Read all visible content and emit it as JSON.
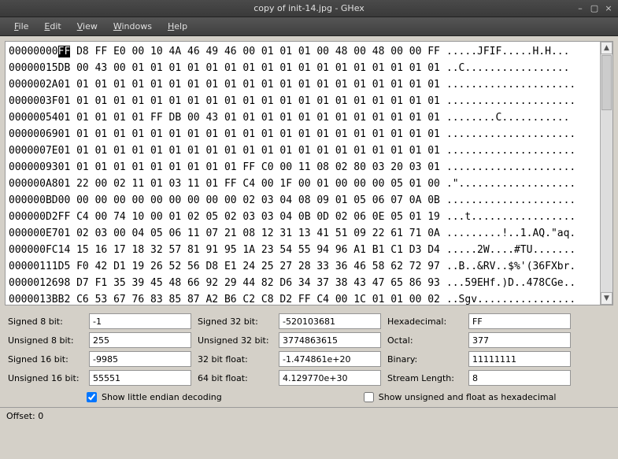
{
  "window": {
    "title": "copy of init-14.jpg - GHex"
  },
  "menu": {
    "file": "File",
    "edit": "Edit",
    "view": "View",
    "windows": "Windows",
    "help": "Help"
  },
  "hex": {
    "lines": [
      {
        "off": "00000000",
        "bytes": "FF D8 FF E0 00 10 4A 46 49 46 00 01 01 01 00 48 00 48 00 00 FF",
        "ascii": ".....JFIF.....H.H...",
        "cur": 0
      },
      {
        "off": "00000015",
        "bytes": "DB 00 43 00 01 01 01 01 01 01 01 01 01 01 01 01 01 01 01 01 01",
        "ascii": "..C................."
      },
      {
        "off": "0000002A",
        "bytes": "01 01 01 01 01 01 01 01 01 01 01 01 01 01 01 01 01 01 01 01 01",
        "ascii": "....................."
      },
      {
        "off": "0000003F",
        "bytes": "01 01 01 01 01 01 01 01 01 01 01 01 01 01 01 01 01 01 01 01 01",
        "ascii": "....................."
      },
      {
        "off": "00000054",
        "bytes": "01 01 01 01 01 FF DB 00 43 01 01 01 01 01 01 01 01 01 01 01 01",
        "ascii": "........C..........."
      },
      {
        "off": "00000069",
        "bytes": "01 01 01 01 01 01 01 01 01 01 01 01 01 01 01 01 01 01 01 01 01",
        "ascii": "....................."
      },
      {
        "off": "0000007E",
        "bytes": "01 01 01 01 01 01 01 01 01 01 01 01 01 01 01 01 01 01 01 01 01",
        "ascii": "....................."
      },
      {
        "off": "00000093",
        "bytes": "01 01 01 01 01 01 01 01 01 01 FF C0 00 11 08 02 80 03 20 03 01",
        "ascii": "....................."
      },
      {
        "off": "000000A8",
        "bytes": "01 22 00 02 11 01 03 11 01 FF C4 00 1F 00 01 00 00 00 05 01 00",
        "ascii": ".\"..................."
      },
      {
        "off": "000000BD",
        "bytes": "00 00 00 00 00 00 00 00 00 00 02 03 04 08 09 01 05 06 07 0A 0B",
        "ascii": "....................."
      },
      {
        "off": "000000D2",
        "bytes": "FF C4 00 74 10 00 01 02 05 02 03 03 04 0B 0D 02 06 0E 05 01 19",
        "ascii": "...t................."
      },
      {
        "off": "000000E7",
        "bytes": "01 02 03 00 04 05 06 11 07 21 08 12 31 13 41 51 09 22 61 71 0A",
        "ascii": ".........!..1.AQ.\"aq."
      },
      {
        "off": "000000FC",
        "bytes": "14 15 16 17 18 32 57 81 91 95 1A 23 54 55 94 96 A1 B1 C1 D3 D4",
        "ascii": ".....2W....#TU......."
      },
      {
        "off": "00000111",
        "bytes": "D5 F0 42 D1 19 26 52 56 D8 E1 24 25 27 28 33 36 46 58 62 72 97",
        "ascii": "..B..&RV..$%'(36FXbr."
      },
      {
        "off": "00000126",
        "bytes": "98 D7 F1 35 39 45 48 66 92 29 44 82 D6 34 37 38 43 47 65 86 93",
        "ascii": "...59EHf.)D..478CGe.."
      },
      {
        "off": "0000013B",
        "bytes": "B2 C6 53 67 76 83 85 87 A2 B6 C2 C8 D2 FF C4 00 1C 01 01 00 02",
        "ascii": "..Sgv................"
      }
    ]
  },
  "fields": {
    "s8_label": "Signed 8 bit:",
    "s8": "-1",
    "u8_label": "Unsigned 8 bit:",
    "u8": "255",
    "s16_label": "Signed 16 bit:",
    "s16": "-9985",
    "u16_label": "Unsigned 16 bit:",
    "u16": "55551",
    "s32_label": "Signed 32 bit:",
    "s32": "-520103681",
    "u32_label": "Unsigned 32 bit:",
    "u32": "3774863615",
    "f32_label": "32 bit float:",
    "f32": "-1.474861e+20",
    "f64_label": "64 bit float:",
    "f64": "4.129770e+30",
    "hex_label": "Hexadecimal:",
    "hex": "FF",
    "oct_label": "Octal:",
    "oct": "377",
    "bin_label": "Binary:",
    "bin": "11111111",
    "slen_label": "Stream Length:",
    "slen": "8"
  },
  "checks": {
    "little_endian": "Show little endian decoding",
    "unsigned_hex": "Show unsigned and float as hexadecimal"
  },
  "status": {
    "offset": "Offset: 0"
  }
}
